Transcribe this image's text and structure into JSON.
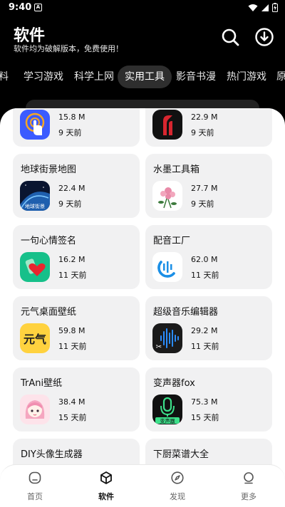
{
  "status_bar": {
    "time": "9:40",
    "notification_letter": "A"
  },
  "header": {
    "title": "软件",
    "subtitle": "软件均为破解版本，免费使用！",
    "search_icon": "search-icon",
    "download_icon": "download-icon"
  },
  "tabs": [
    {
      "label": "料"
    },
    {
      "label": "学习游戏"
    },
    {
      "label": "科学上网"
    },
    {
      "label": "实用工具"
    },
    {
      "label": "影音书漫"
    },
    {
      "label": "热门游戏"
    },
    {
      "label": "原"
    }
  ],
  "active_tab": "实用工具",
  "apps": [
    {
      "name": "",
      "size": "15.8 M",
      "date": "9 天前",
      "icon": "touch-icon"
    },
    {
      "name": "",
      "size": "22.9 M",
      "date": "9 天前",
      "icon": "red-arc-icon"
    },
    {
      "name": "地球街景地图",
      "size": "22.4 M",
      "date": "9 天前",
      "icon": "earth-street-view-icon"
    },
    {
      "name": "水墨工具箱",
      "size": "27.7 M",
      "date": "9 天前",
      "icon": "ink-flower-icon"
    },
    {
      "name": "一句心情签名",
      "size": "16.2 M",
      "date": "11 天前",
      "icon": "heart-bottle-icon"
    },
    {
      "name": "配音工厂",
      "size": "62.0 M",
      "date": "11 天前",
      "icon": "dubbing-factory-icon"
    },
    {
      "name": "元气桌面壁纸",
      "size": "59.8 M",
      "date": "11 天前",
      "icon": "yuanqi-wallpaper-icon"
    },
    {
      "name": "超级音乐编辑器",
      "size": "29.2 M",
      "date": "11 天前",
      "icon": "music-editor-icon"
    },
    {
      "name": "TrAni壁纸",
      "size": "38.4 M",
      "date": "15 天前",
      "icon": "anime-girl-icon"
    },
    {
      "name": "变声器fox",
      "size": "75.3 M",
      "date": "15 天前",
      "icon": "voice-changer-icon"
    },
    {
      "name": "DIY头像生成器",
      "size": "",
      "date": "",
      "icon": ""
    },
    {
      "name": "下厨菜谱大全",
      "size": "",
      "date": "",
      "icon": ""
    }
  ],
  "icon_texts": {
    "earth": "地球街景",
    "voice_changer": "变声器",
    "yuanqi": "元气"
  },
  "bottom_nav": [
    {
      "label": "首页",
      "icon": "home-icon"
    },
    {
      "label": "软件",
      "icon": "cube-icon"
    },
    {
      "label": "发现",
      "icon": "compass-icon"
    },
    {
      "label": "更多",
      "icon": "more-icon"
    }
  ],
  "active_nav": "软件"
}
